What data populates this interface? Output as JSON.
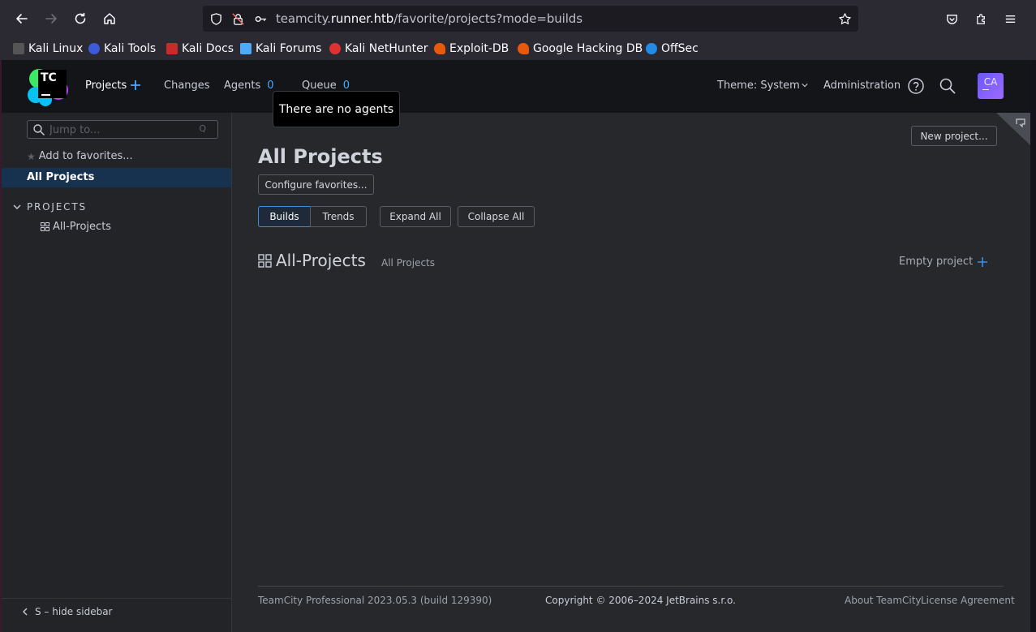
{
  "browser": {
    "url_prefix": "teamcity.",
    "url_host": "runner.htb",
    "url_path": "/favorite/projects?mode=builds",
    "bookmarks": [
      {
        "label": "Kali Linux",
        "color": "#3a3a3a"
      },
      {
        "label": "Kali Tools",
        "color": "#3b5bdb"
      },
      {
        "label": "Kali Docs",
        "color": "#c92a2a"
      },
      {
        "label": "Kali Forums",
        "color": "#4dabf7"
      },
      {
        "label": "Kali NetHunter",
        "color": "#e03131"
      },
      {
        "label": "Exploit-DB",
        "color": "#e8590c"
      },
      {
        "label": "Google Hacking DB",
        "color": "#e8590c"
      },
      {
        "label": "OffSec",
        "color": "#228be6"
      }
    ]
  },
  "header": {
    "logo_text": "TC",
    "projects_label": "Projects",
    "changes_label": "Changes",
    "agents_label": "Agents",
    "agents_count": "0",
    "queue_label": "Queue",
    "queue_count": "0",
    "theme_label": "Theme: System",
    "administration_label": "Administration",
    "avatar_initials": "CA",
    "tooltip_text": "There are no agents"
  },
  "sidebar": {
    "jump_placeholder": "Jump to...",
    "jump_shortcut": "Q",
    "add_favorites_label": "Add to favorites...",
    "all_projects_label": "All Projects",
    "section_label": "PROJECTS",
    "project_item_label": "All-Projects",
    "hide_sidebar_label": "S – hide sidebar"
  },
  "main": {
    "new_project_label": "New project...",
    "page_title": "All Projects",
    "configure_favorites_label": "Configure favorites...",
    "builds_label": "Builds",
    "trends_label": "Trends",
    "expand_all_label": "Expand All",
    "collapse_all_label": "Collapse All",
    "project_name": "All-Projects",
    "project_breadcrumb": "All Projects",
    "project_status": "Empty project"
  },
  "footer": {
    "version": "TeamCity Professional 2023.05.3 (build 129390)",
    "copyright": "Copyright © 2006–2024 JetBrains s.r.o.",
    "about_label": "About TeamCity",
    "license_label": "License Agreement"
  },
  "colors": {
    "accent": "#4ca8ff",
    "selected_bg": "#17324f",
    "header_bg": "#141518"
  }
}
